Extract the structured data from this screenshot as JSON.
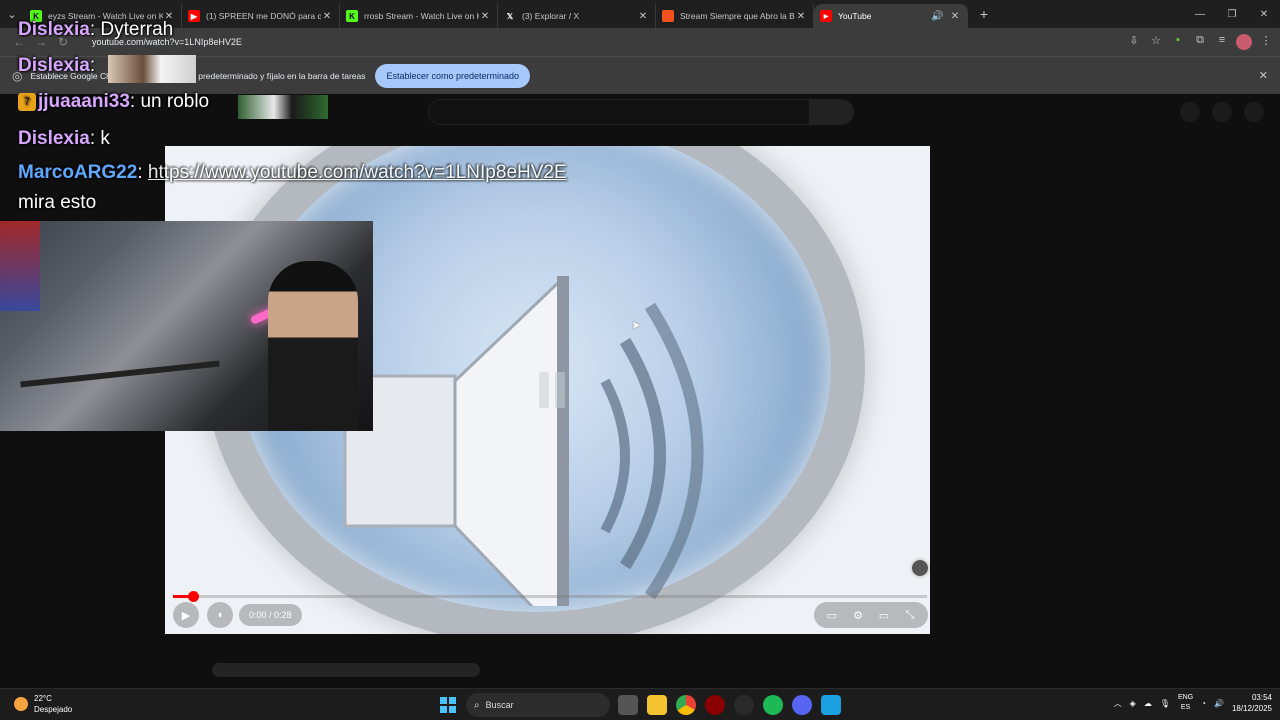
{
  "browser": {
    "tabs": [
      {
        "title": "eyzs Stream - Watch Live on Ki",
        "favicon": "kick-icon",
        "color": "#53fc18"
      },
      {
        "title": "(1) SPREEN me DONÓ para que",
        "favicon": "youtube-icon",
        "color": "#ff0000"
      },
      {
        "title": "rrosb Stream - Watch Live on K",
        "favicon": "kick-icon",
        "color": "#53fc18"
      },
      {
        "title": "(3) Explorar / X",
        "favicon": "x-icon",
        "color": "#ffffff"
      },
      {
        "title": "Stream Siempre que Abro la Bo",
        "favicon": "slides-icon",
        "color": "#f4511e"
      },
      {
        "title": "YouTube",
        "favicon": "youtube-icon",
        "color": "#ff0000"
      }
    ],
    "url": "youtube.com/watch?v=1LNIp8eHV2E",
    "infobar": {
      "text": "Establece Google Chrome como navegador predeterminado y fíjalo en la barra de tareas",
      "button": "Establecer como predeterminado"
    }
  },
  "chat": [
    {
      "user": "Dislexia",
      "msg": "Dyterrah",
      "color": "#d7a6ff"
    },
    {
      "user": "Dislexia",
      "msg": "",
      "color": "#d7a6ff"
    },
    {
      "user": "jjuaaani33",
      "msg": "un roblo",
      "color": "#d7a6ff"
    },
    {
      "user": "Dislexia",
      "msg": "k",
      "color": "#d7a6ff"
    },
    {
      "user": "MarcoARG22",
      "msg": "https://www.youtube.com/watch?v=1LNIp8eHV2E",
      "color": "#5ea8ff"
    },
    {
      "user": "",
      "msg": "mira esto",
      "color": "#ffffff"
    }
  ],
  "player": {
    "time": "0:00 / 0:28",
    "progress": 0.026
  },
  "taskbar": {
    "weather_temp": "22°C",
    "weather_desc": "Despejado",
    "search": "Buscar",
    "lang_top": "ENG",
    "lang_bottom": "ES",
    "time": "03:54",
    "date": "18/12/2025"
  }
}
